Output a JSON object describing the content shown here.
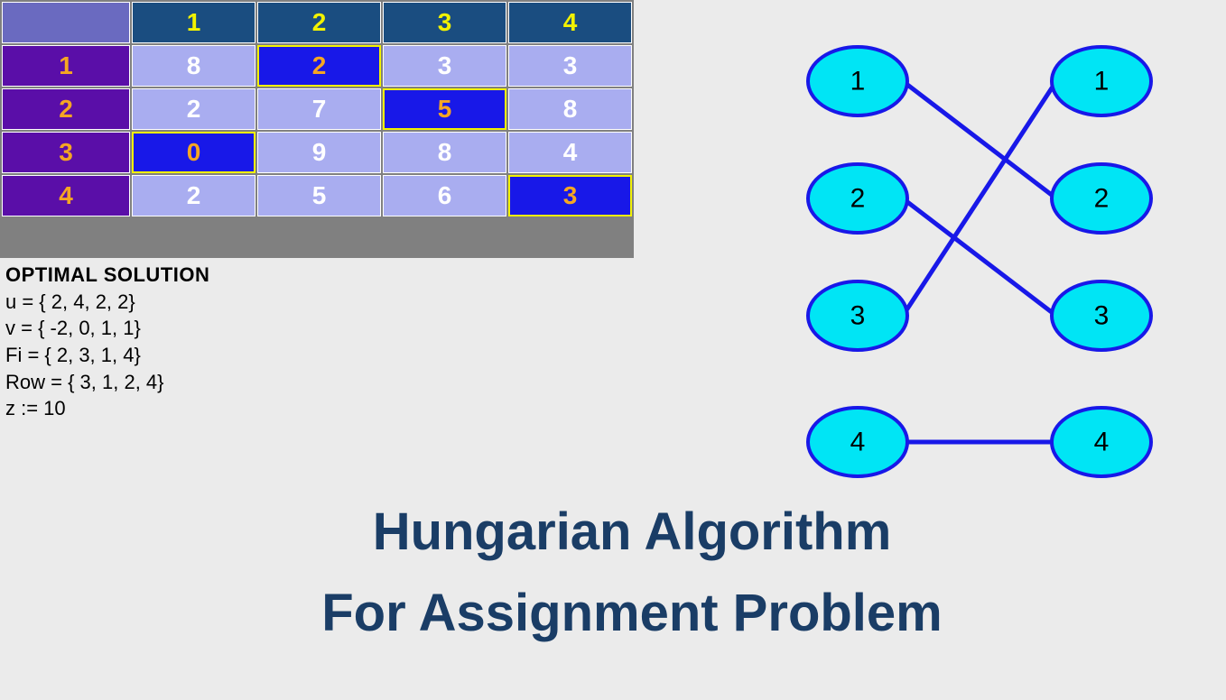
{
  "matrix": {
    "column_headers": [
      "1",
      "2",
      "3",
      "4"
    ],
    "row_headers": [
      "1",
      "2",
      "3",
      "4"
    ],
    "cells": [
      [
        "8",
        "2",
        "3",
        "3"
      ],
      [
        "2",
        "7",
        "5",
        "8"
      ],
      [
        "0",
        "9",
        "8",
        "4"
      ],
      [
        "2",
        "5",
        "6",
        "3"
      ]
    ],
    "selected": [
      [
        0,
        1
      ],
      [
        1,
        2
      ],
      [
        2,
        0
      ],
      [
        3,
        3
      ]
    ]
  },
  "solution": {
    "title": "OPTIMAL SOLUTION",
    "lines": [
      "u = { 2, 4, 2, 2}",
      "v = { -2, 0, 1, 1}",
      "Fi = { 2, 3, 1, 4}",
      "Row = { 3, 1, 2, 4}",
      "z := 10"
    ]
  },
  "graph": {
    "left_nodes": [
      "1",
      "2",
      "3",
      "4"
    ],
    "right_nodes": [
      "1",
      "2",
      "3",
      "4"
    ],
    "edges": [
      {
        "from": 0,
        "to": 1
      },
      {
        "from": 1,
        "to": 2
      },
      {
        "from": 2,
        "to": 0
      },
      {
        "from": 3,
        "to": 3
      }
    ]
  },
  "title": {
    "line1": "Hungarian Algorithm",
    "line2": "For Assignment Problem"
  },
  "chart_data": {
    "type": "table",
    "description": "Assignment cost matrix with optimal assignment highlighted",
    "categories_rows": [
      "1",
      "2",
      "3",
      "4"
    ],
    "categories_cols": [
      "1",
      "2",
      "3",
      "4"
    ],
    "values": [
      [
        8,
        2,
        3,
        3
      ],
      [
        2,
        7,
        5,
        8
      ],
      [
        0,
        9,
        8,
        4
      ],
      [
        2,
        5,
        6,
        3
      ]
    ],
    "assignment": {
      "1": "2",
      "2": "3",
      "3": "1",
      "4": "4"
    },
    "bipartite_edges": [
      [
        1,
        2
      ],
      [
        2,
        3
      ],
      [
        3,
        1
      ],
      [
        4,
        4
      ]
    ],
    "u": [
      2,
      4,
      2,
      2
    ],
    "v": [
      -2,
      0,
      1,
      1
    ],
    "Fi": [
      2,
      3,
      1,
      4
    ],
    "Row": [
      3,
      1,
      2,
      4
    ],
    "z": 10
  }
}
